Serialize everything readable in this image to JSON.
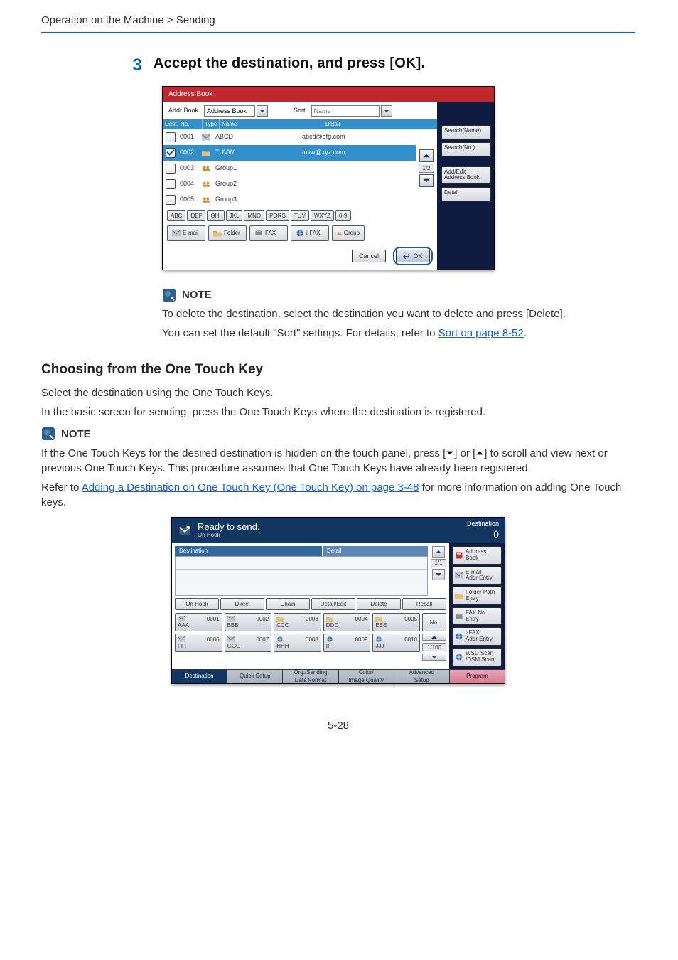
{
  "breadcrumb": "Operation on the Machine > Sending",
  "step": {
    "number": "3",
    "title": "Accept the destination, and press [OK]."
  },
  "address_book": {
    "titlebar": "Address Book",
    "labels": {
      "addr_book": "Addr Book",
      "sort": "Sort"
    },
    "dropdown_value": "Address Book",
    "name_input_placeholder": "Name",
    "columns": {
      "dest": "Dest.",
      "no": "No.",
      "type": "Type",
      "name": "Name",
      "detail": "Detail"
    },
    "rows": [
      {
        "checked": false,
        "no": "0001",
        "icon": "envelope",
        "name": "ABCD",
        "detail": "abcd@efg.com"
      },
      {
        "checked": true,
        "no": "0002",
        "icon": "folder",
        "name": "TUVW",
        "detail": "tuvw@xyz.com"
      },
      {
        "checked": false,
        "no": "0003",
        "icon": "group",
        "name": "Group1",
        "detail": ""
      },
      {
        "checked": false,
        "no": "0004",
        "icon": "group",
        "name": "Group2",
        "detail": ""
      },
      {
        "checked": false,
        "no": "0005",
        "icon": "group",
        "name": "Group3",
        "detail": ""
      }
    ],
    "page_indicator": "1/2",
    "alpha": [
      "ABC",
      "DEF",
      "GHI",
      "JKL",
      "MNO",
      "PQRS",
      "TUV",
      "WXYZ",
      "0-9"
    ],
    "tabs": {
      "email": "E-mail",
      "folder": "Folder",
      "fax": "FAX",
      "ifax": "i-FAX",
      "group": "Group"
    },
    "side": {
      "search_name": "Search(Name)",
      "search_no": "Search(No.)",
      "add_edit": "Add/Edit\nAddress Book",
      "detail": "Detail"
    },
    "buttons": {
      "cancel": "Cancel",
      "ok": "OK"
    }
  },
  "note1": {
    "label": "NOTE",
    "line1": "To delete the destination, select the destination you want to delete and press [Delete].",
    "line2_prefix": "You can set the default \"Sort\" settings. For details, refer to ",
    "line2_link": "Sort on page 8-52",
    "line2_suffix": "."
  },
  "section": {
    "heading": "Choosing from the One Touch Key",
    "p1": "Select the destination using the One Touch Keys.",
    "p2": "In the basic screen for sending, press the One Touch Keys where the destination is registered."
  },
  "note2": {
    "label": "NOTE",
    "line1": "If the One Touch Keys for the desired destination is hidden on the touch panel, press [",
    "line1_mid": "] or [",
    "line1_end": "] to scroll and view next or previous One Touch Keys. This procedure assumes that One Touch Keys have already been registered.",
    "line2_prefix": "Refer to ",
    "line2_link": "Adding a Destination on One Touch Key (One Touch Key) on page 3-48",
    "line2_suffix": " for more information on adding One Touch keys."
  },
  "ready_send": {
    "title": "Ready to send.",
    "subtitle": "On Hook",
    "dest_label": "Destination",
    "dest_count": "0",
    "head": {
      "destination": "Destination",
      "detail": "Detail"
    },
    "page_indicator": "1/1",
    "actions": [
      "On Hook",
      "Direct",
      "Chain",
      "Detail/Edit",
      "Delete",
      "Recall"
    ],
    "onetouch": [
      {
        "num": "0001",
        "name": "AAA",
        "icon": "envelope"
      },
      {
        "num": "0002",
        "name": "BBB",
        "icon": "envelope"
      },
      {
        "num": "0003",
        "name": "CCC",
        "icon": "folder"
      },
      {
        "num": "0004",
        "name": "DDD",
        "icon": "folder"
      },
      {
        "num": "0005",
        "name": "EEE",
        "icon": "folder"
      },
      {
        "num": "0006",
        "name": "FFF",
        "icon": "envelope"
      },
      {
        "num": "0007",
        "name": "GGG",
        "icon": "envelope"
      },
      {
        "num": "0008",
        "name": "HHH",
        "icon": "ifax"
      },
      {
        "num": "0009",
        "name": "III",
        "icon": "ifax"
      },
      {
        "num": "0010",
        "name": "JJJ",
        "icon": "ifax"
      }
    ],
    "no_button": "No.",
    "ot_page": "1/100",
    "side": {
      "address_book": "Address\nBook",
      "email_entry": "E-mail\nAddr Entry",
      "folder_entry": "Folder Path\nEntry",
      "fax_no_entry": "FAX No.\nEntry",
      "ifax_entry": "i-FAX\nAddr Entry",
      "wsd_scan": "WSD Scan\n/DSM Scan"
    },
    "bottom_tabs": [
      "Destination",
      "Quick Setup",
      "Org./Sending\nData Format",
      "Color/\nImage Quality",
      "Advanced\nSetup",
      "Program"
    ]
  },
  "page_number": "5-28"
}
